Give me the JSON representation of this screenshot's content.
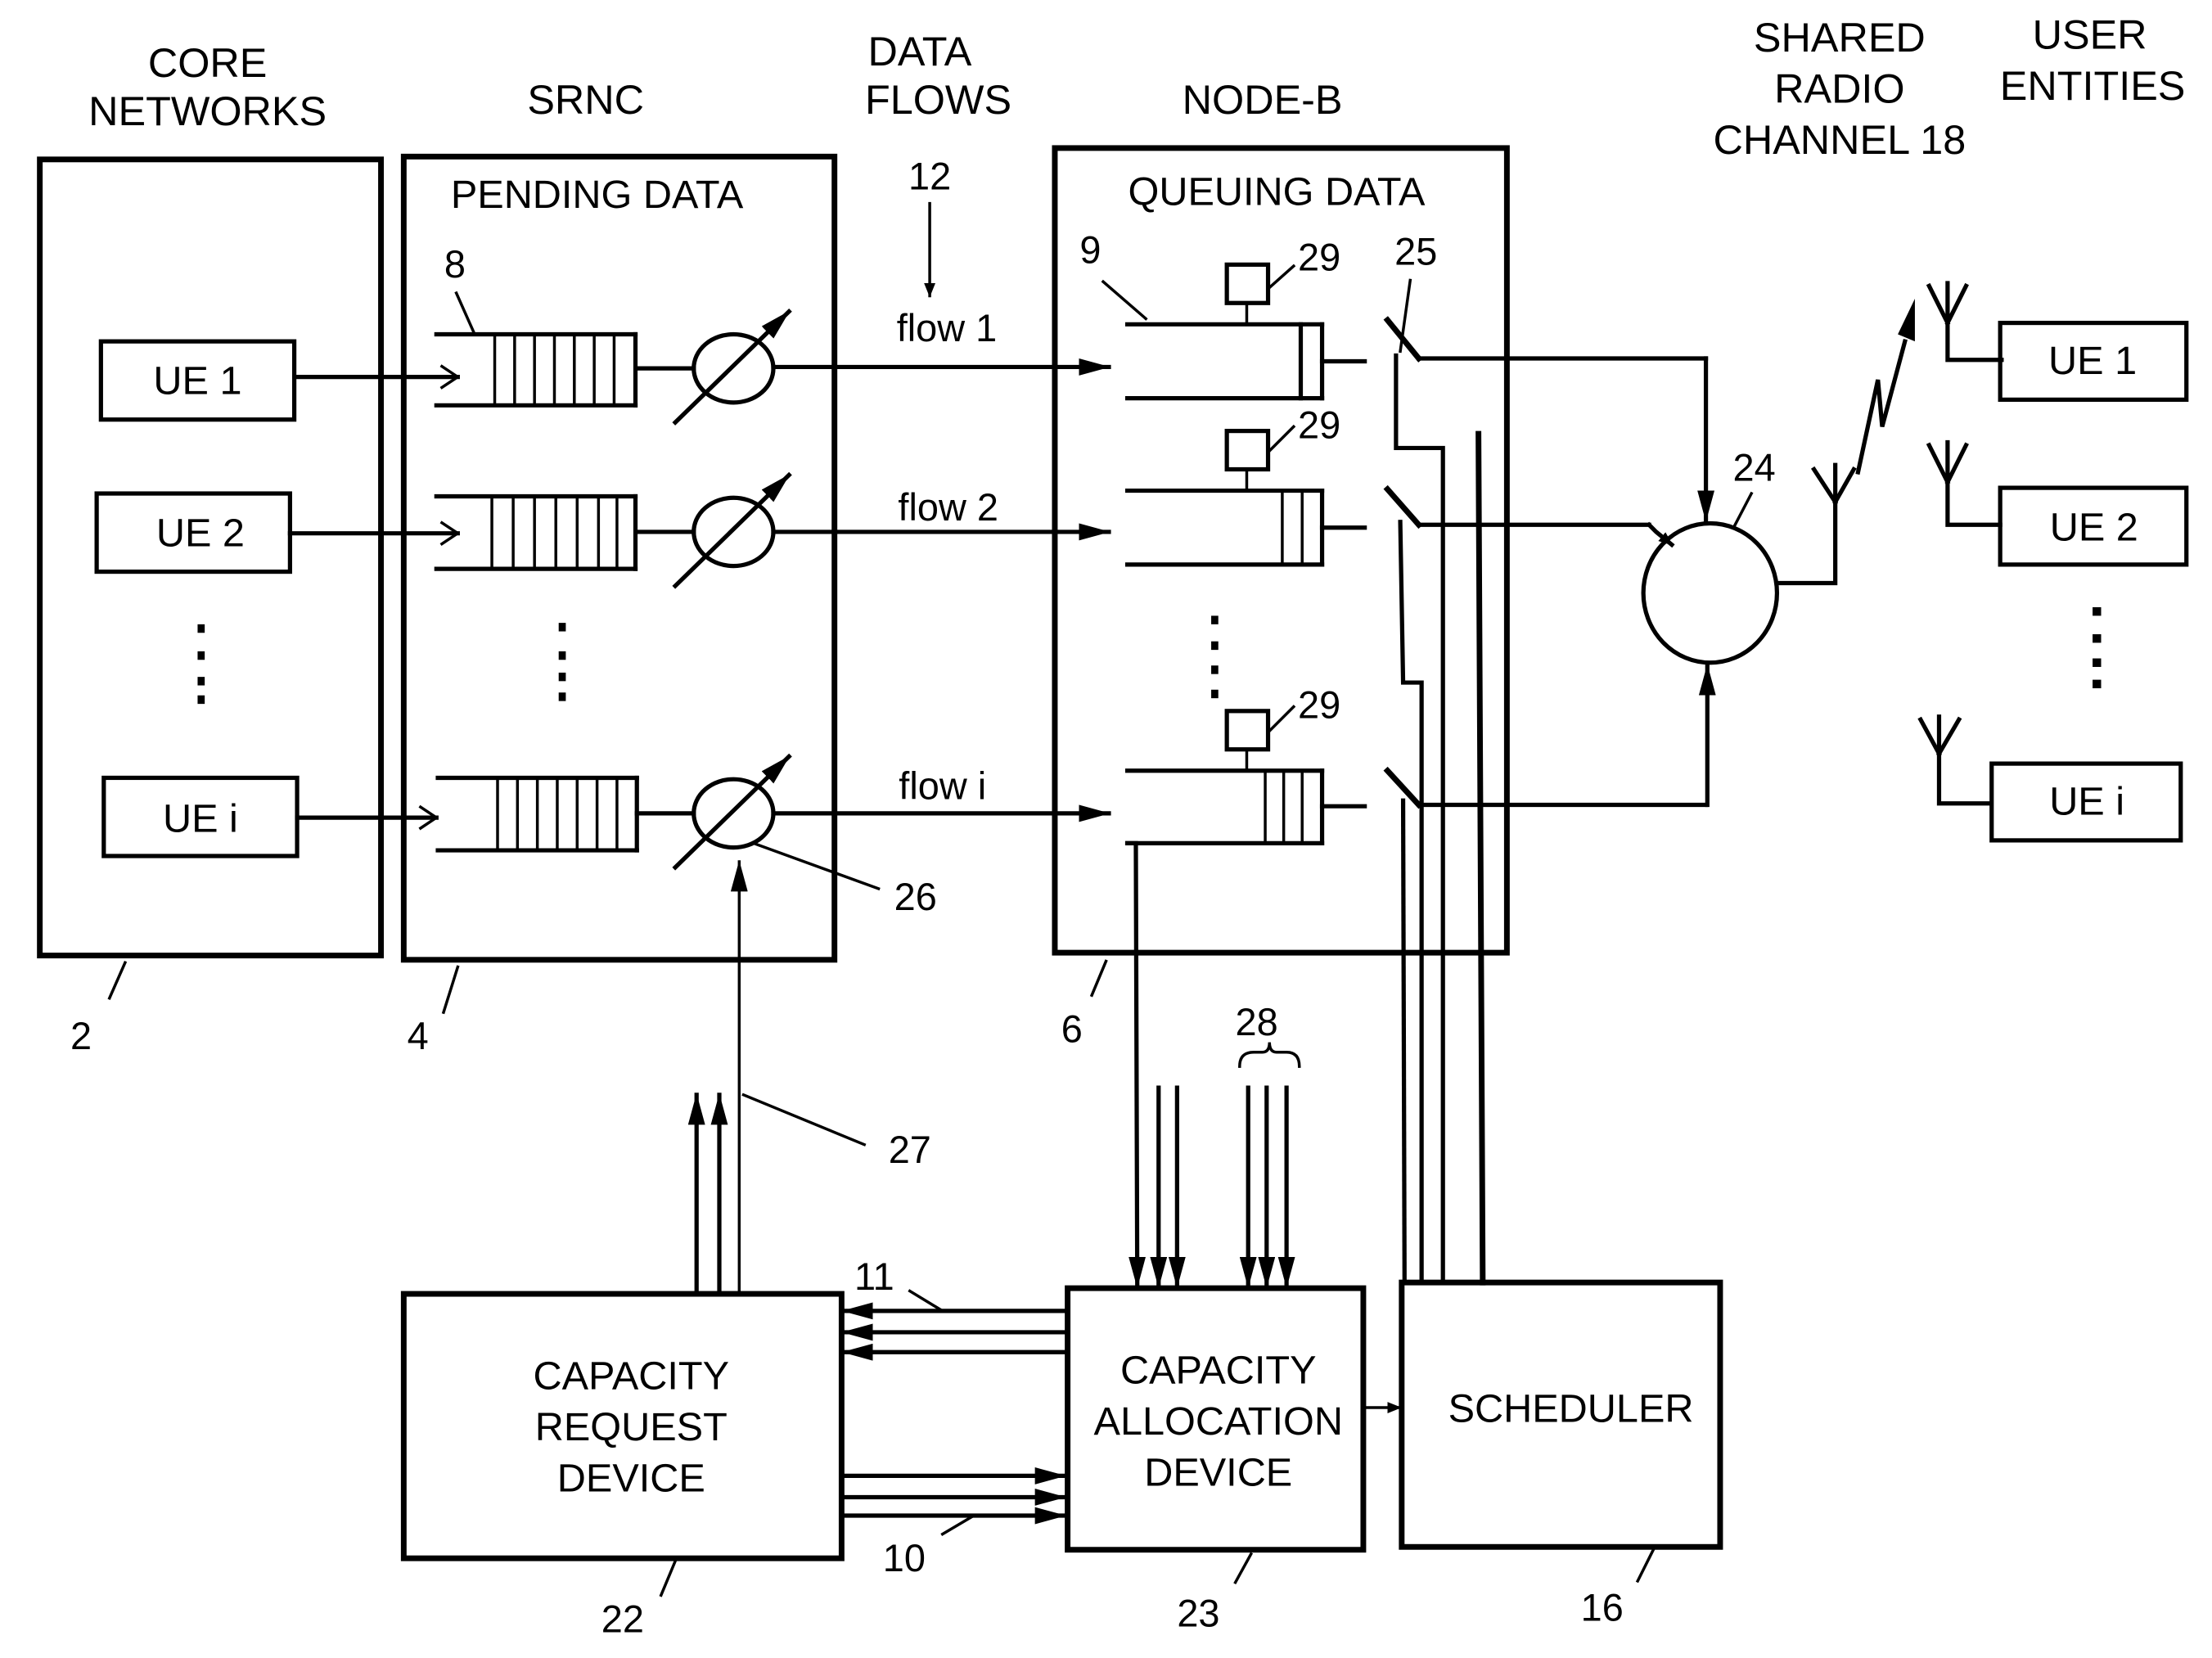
{
  "headers": {
    "core_networks": [
      "CORE",
      "NETWORKS"
    ],
    "srnc": "SRNC",
    "data_flows": [
      "DATA",
      "FLOWS"
    ],
    "node_b": "NODE-B",
    "shared_radio": [
      "SHARED",
      "RADIO",
      "CHANNEL 18"
    ],
    "user_entities": [
      "USER",
      "ENTITIES"
    ]
  },
  "core_network": {
    "ref": "2",
    "ues": [
      "UE 1",
      "UE 2",
      "UE i"
    ]
  },
  "srnc": {
    "ref": "4",
    "title": "PENDING DATA",
    "queue_ref": "8",
    "regulator_ref": "26"
  },
  "flows": {
    "ref": "12",
    "labels": [
      "flow 1",
      "flow 2",
      "flow i"
    ]
  },
  "node_b": {
    "ref": "6",
    "title": "QUEUING DATA",
    "queue_ref": "9",
    "monitor_ref": "29",
    "switch_ref": "25"
  },
  "combiner": {
    "ref": "24"
  },
  "user_entities": {
    "ues": [
      "UE 1",
      "UE 2",
      "UE i"
    ]
  },
  "bottom": {
    "capacity_request": {
      "lines": [
        "CAPACITY",
        "REQUEST",
        "DEVICE"
      ],
      "ref": "22"
    },
    "capacity_allocation": {
      "lines": [
        "CAPACITY",
        "ALLOCATION",
        "DEVICE"
      ],
      "ref": "23"
    },
    "scheduler": {
      "label": "SCHEDULER",
      "ref": "16"
    },
    "refs": {
      "r10": "10",
      "r11": "11",
      "r27": "27",
      "r28": "28"
    }
  }
}
